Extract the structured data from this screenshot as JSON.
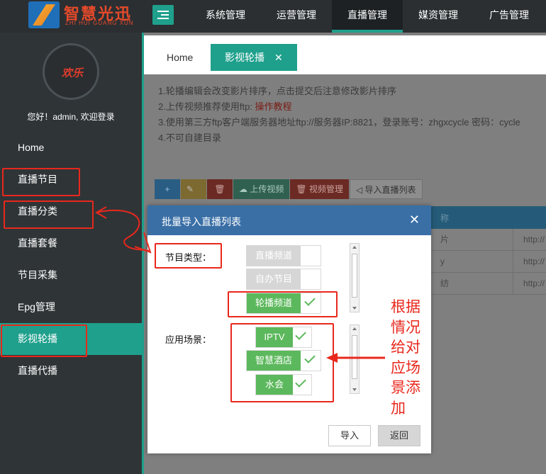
{
  "brand": {
    "title": "智慧光迅",
    "subtitle": "ZHI HUI GUANG XUN"
  },
  "nav": [
    {
      "label": "系统管理"
    },
    {
      "label": "运营管理"
    },
    {
      "label": "直播管理",
      "active": true
    },
    {
      "label": "媒资管理"
    },
    {
      "label": "广告管理"
    }
  ],
  "sidebar": {
    "avatar_text": "欢乐",
    "welcome": "您好！admin, 欢迎登录",
    "items": [
      {
        "label": "Home"
      },
      {
        "label": "直播节目"
      },
      {
        "label": "直播分类"
      },
      {
        "label": "直播套餐"
      },
      {
        "label": "节目采集"
      },
      {
        "label": "Epg管理"
      },
      {
        "label": "影视轮播",
        "active": true
      },
      {
        "label": "直播代播"
      }
    ]
  },
  "tabs": [
    {
      "label": "Home"
    },
    {
      "label": "影视轮播",
      "active": true,
      "close": "✕"
    }
  ],
  "notes": {
    "line1": "1.轮播编辑会改变影片排序，点击提交后注意修改影片排序",
    "line2_prefix": "2.上传视频推荐使用ftp:",
    "line2_link": "操作教程",
    "line3": "3.使用第三方ftp客户端服务器地址ftp://服务器IP:8821，登录账号：zhgxcycle 密码：cycle",
    "line4": "4.不可自建目录"
  },
  "toolbar": {
    "add_icon": "+",
    "delete_icon": "🗑",
    "upload_label": "上传视频",
    "manage_label": "视频管理",
    "import_label": "导入直播列表"
  },
  "table": {
    "header_partial": "称",
    "rows": [
      {
        "name": "片",
        "url": "http://"
      },
      {
        "name": "y",
        "url": "http://"
      },
      {
        "name": "纺",
        "url": "http://"
      }
    ]
  },
  "modal": {
    "title": "批量导入直播列表",
    "close": "✕",
    "type_label": "节目类型：",
    "types": [
      {
        "label": "直播频道",
        "selected": false
      },
      {
        "label": "自办节目",
        "selected": false
      },
      {
        "label": "轮播频道",
        "selected": true
      }
    ],
    "scene_label": "应用场景：",
    "scenes": [
      {
        "label": "IPTV",
        "selected": true
      },
      {
        "label": "智慧酒店",
        "selected": true
      },
      {
        "label": "水会",
        "selected": true
      }
    ],
    "import_button": "导入",
    "back_button": "返回"
  },
  "annotation": {
    "text": "根据情况给对应场景添加",
    "color": "#e8281c"
  },
  "colors": {
    "accent": "#1fa08c",
    "modal_header": "#3a6fa6",
    "selected_green": "#5cb85c"
  }
}
